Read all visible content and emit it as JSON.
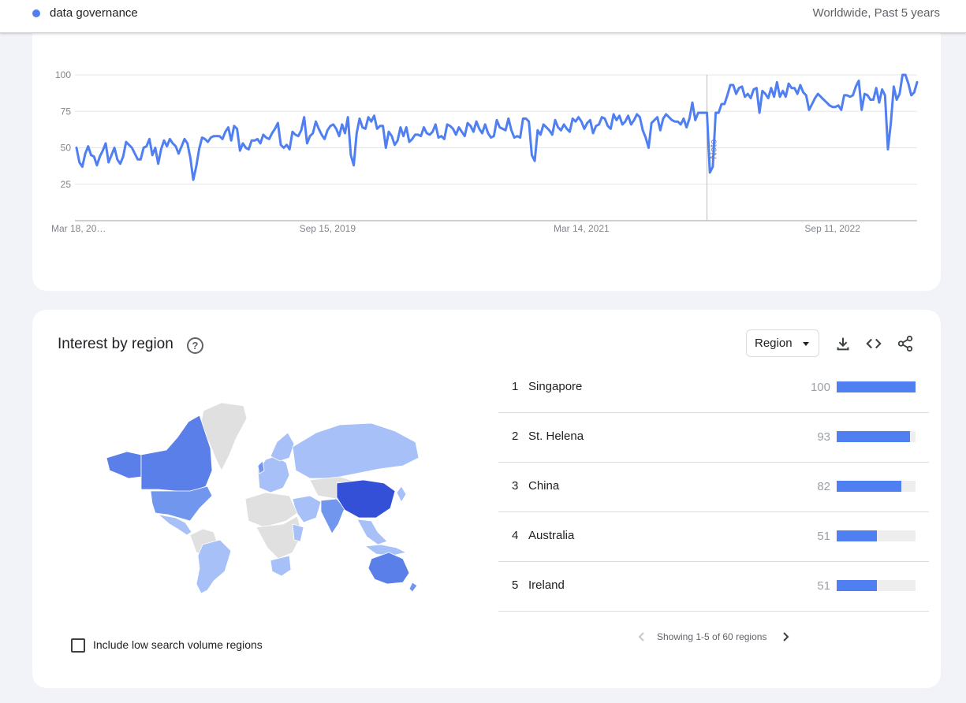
{
  "header": {
    "term": "data governance",
    "term_color": "#4f7ff0",
    "scope": "Worldwide, Past 5 years"
  },
  "chart_data": {
    "type": "line",
    "series_color": "#4f7ff0",
    "ylim": [
      0,
      100
    ],
    "y_ticks": [
      25,
      50,
      75,
      100
    ],
    "x_tick_labels": [
      "Mar 18, 20…",
      "Sep 15, 2019",
      "Mar 14, 2021",
      "Sep 11, 2022"
    ],
    "note_label": "Note",
    "grid": true,
    "values": [
      50,
      40,
      37,
      46,
      51,
      45,
      44,
      38,
      44,
      48,
      53,
      40,
      45,
      50,
      42,
      39,
      44,
      54,
      52,
      50,
      46,
      42,
      42,
      50,
      51,
      56,
      45,
      50,
      39,
      49,
      55,
      51,
      56,
      53,
      51,
      46,
      51,
      56,
      53,
      43,
      28,
      37,
      49,
      57,
      56,
      54,
      57,
      58,
      58,
      58,
      56,
      61,
      64,
      55,
      65,
      63,
      48,
      53,
      50,
      49,
      55,
      55,
      56,
      53,
      59,
      57,
      56,
      60,
      63,
      67,
      52,
      50,
      52,
      49,
      61,
      59,
      58,
      62,
      71,
      53,
      58,
      60,
      68,
      63,
      59,
      56,
      62,
      65,
      66,
      63,
      58,
      66,
      60,
      71,
      45,
      38,
      60,
      70,
      64,
      63,
      71,
      68,
      72,
      63,
      65,
      65,
      50,
      61,
      58,
      52,
      55,
      64,
      58,
      64,
      54,
      56,
      59,
      59,
      58,
      64,
      60,
      59,
      61,
      66,
      57,
      58,
      56,
      66,
      65,
      63,
      59,
      64,
      61,
      58,
      67,
      65,
      61,
      68,
      63,
      60,
      66,
      60,
      57,
      58,
      69,
      64,
      63,
      62,
      70,
      62,
      57,
      58,
      57,
      70,
      70,
      68,
      45,
      41,
      62,
      59,
      66,
      64,
      62,
      59,
      69,
      64,
      62,
      66,
      63,
      61,
      70,
      68,
      71,
      68,
      63,
      67,
      69,
      60,
      65,
      66,
      71,
      70,
      65,
      63,
      73,
      69,
      72,
      66,
      68,
      72,
      66,
      69,
      73,
      71,
      62,
      57,
      50,
      67,
      69,
      71,
      62,
      70,
      73,
      71,
      69,
      68,
      68,
      66,
      70,
      64,
      70,
      81,
      69,
      74,
      74,
      74,
      74,
      33,
      37,
      74,
      74,
      80,
      80,
      86,
      93,
      93,
      87,
      91,
      92,
      85,
      87,
      84,
      90,
      91,
      74,
      89,
      87,
      84,
      91,
      85,
      95,
      85,
      89,
      85,
      94,
      91,
      91,
      87,
      93,
      88,
      86,
      76,
      80,
      84,
      87,
      85,
      83,
      81,
      79,
      78,
      78,
      79,
      76,
      86,
      86,
      85,
      86,
      92,
      96,
      76,
      87,
      86,
      83,
      83,
      91,
      81,
      90,
      86,
      49,
      67,
      92,
      83,
      87,
      100,
      100,
      94,
      86,
      88,
      95
    ]
  },
  "region": {
    "title": "Interest by region",
    "help_icon": "help-icon",
    "select_label": "Region",
    "tools": [
      "download-icon",
      "embed-icon",
      "share-icon"
    ],
    "ranks": [
      {
        "rank": "1",
        "name": "Singapore",
        "value": "100",
        "level": 100
      },
      {
        "rank": "2",
        "name": "St. Helena",
        "value": "93",
        "level": 93
      },
      {
        "rank": "3",
        "name": "China",
        "value": "82",
        "level": 82
      },
      {
        "rank": "4",
        "name": "Australia",
        "value": "51",
        "level": 51
      },
      {
        "rank": "5",
        "name": "Ireland",
        "value": "51",
        "level": 51
      }
    ],
    "bar_color": "#4f7ff0",
    "pager_text": "Showing 1-5 of 60 regions",
    "checkbox_label": "Include low search volume regions",
    "map_colors": {
      "none": "#e0e0e0",
      "low": "#a8c0f8",
      "mid": "#7196ee",
      "high": "#5a7fe8",
      "top": "#3350d6"
    }
  }
}
